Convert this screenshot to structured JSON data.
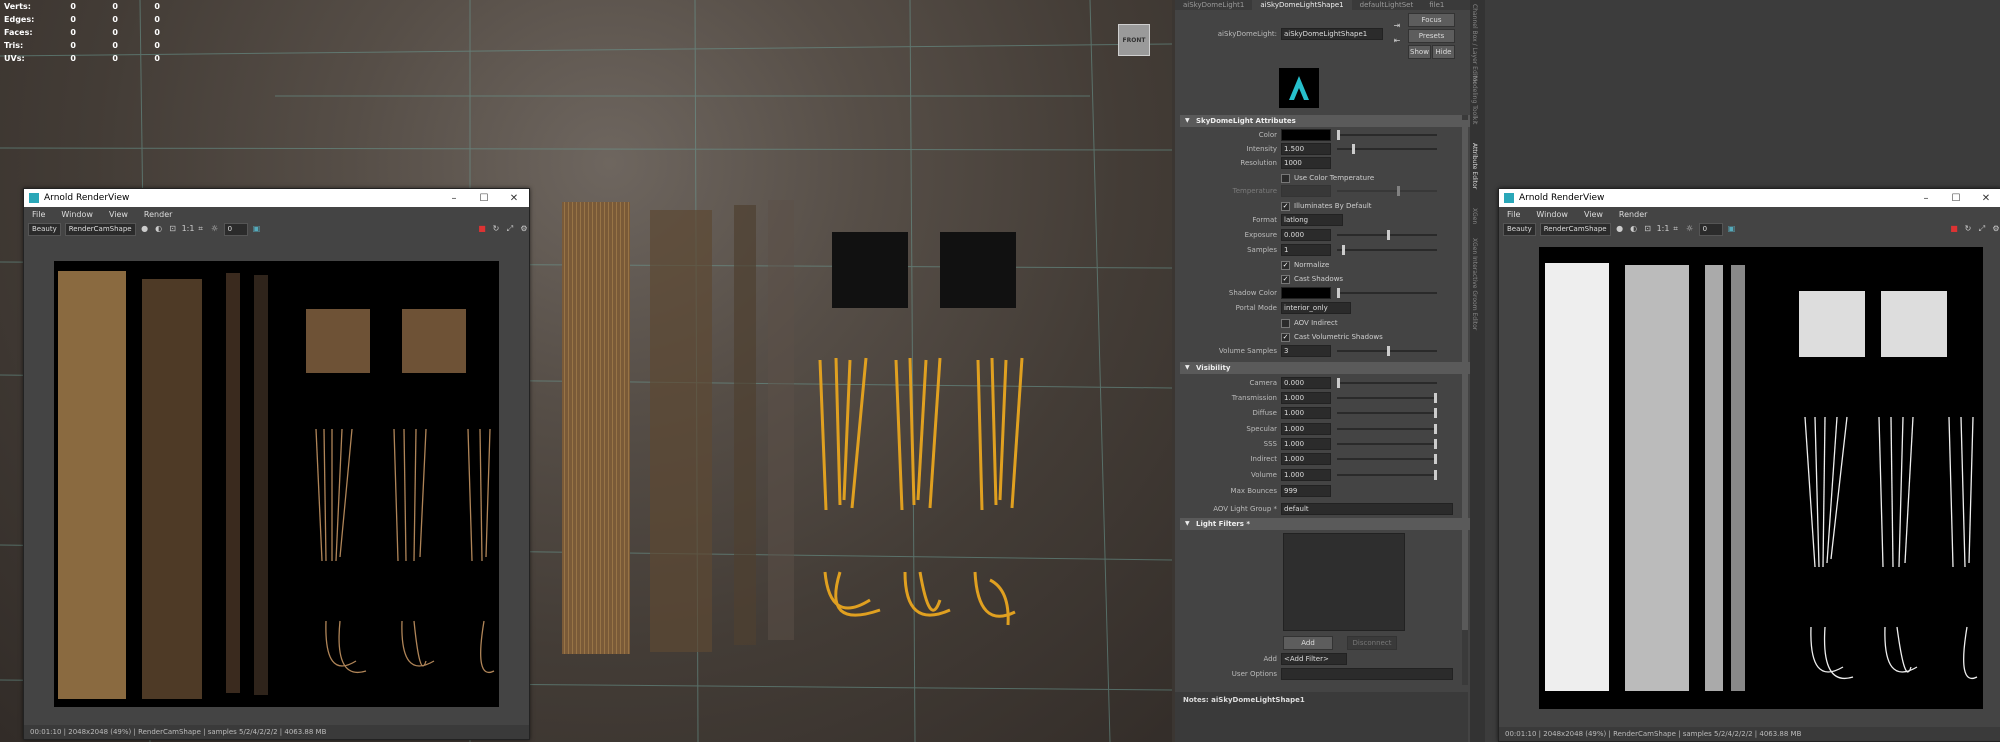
{
  "viewport": {
    "hud_labels": [
      "Verts:",
      "Edges:",
      "Faces:",
      "Tris:",
      "UVs:"
    ],
    "hud_values": [
      [
        "0",
        "0",
        "0"
      ],
      [
        "0",
        "0",
        "0"
      ],
      [
        "0",
        "0",
        "0"
      ],
      [
        "0",
        "0",
        "0"
      ],
      [
        "0",
        "0",
        "0"
      ]
    ],
    "cube_label": "FRONT"
  },
  "renderview_left": {
    "title": "Arnold RenderView",
    "menu": [
      "File",
      "Window",
      "View",
      "Render"
    ],
    "aov": "Beauty",
    "camera": "RenderCamShape",
    "zoom_ratio": "1:1",
    "exposure": "0",
    "status": "00:01:10 | 2048x2048 (49%) | RenderCamShape  | samples 5/2/4/2/2/2 | 4063.88 MB"
  },
  "attribute_editor": {
    "tabs": [
      "aiSkyDomeLight1",
      "aiSkyDomeLightShape1",
      "defaultLightSet",
      "file1"
    ],
    "node_label": "aiSkyDomeLight:",
    "node_name": "aiSkyDomeLightShape1",
    "buttons": {
      "focus": "Focus",
      "presets": "Presets",
      "show": "Show",
      "hide": "Hide"
    },
    "section_sky": "SkyDomeLight Attributes",
    "color_label": "Color",
    "intensity_label": "Intensity",
    "intensity": "1.500",
    "resolution_label": "Resolution",
    "resolution": "1000",
    "use_color_temp": "Use Color Temperature",
    "temperature_label": "Temperature",
    "illum_default": "Illuminates By Default",
    "format_label": "Format",
    "format": "latlong",
    "exposure_label": "Exposure",
    "exposure": "0.000",
    "samples_label": "Samples",
    "samples": "1",
    "normalize": "Normalize",
    "cast_shadows": "Cast Shadows",
    "shadow_color_label": "Shadow Color",
    "portal_mode_label": "Portal Mode",
    "portal_mode": "interior_only",
    "aov_indirect": "AOV Indirect",
    "cast_vol_shadows": "Cast Volumetric Shadows",
    "volume_samples_label": "Volume Samples",
    "volume_samples": "3",
    "section_visibility": "Visibility",
    "vis_rows": [
      {
        "label": "Camera",
        "value": "0.000"
      },
      {
        "label": "Transmission",
        "value": "1.000"
      },
      {
        "label": "Diffuse",
        "value": "1.000"
      },
      {
        "label": "Specular",
        "value": "1.000"
      },
      {
        "label": "SSS",
        "value": "1.000"
      },
      {
        "label": "Indirect",
        "value": "1.000"
      },
      {
        "label": "Volume",
        "value": "1.000"
      }
    ],
    "max_bounces_label": "Max Bounces",
    "max_bounces": "999",
    "aov_group_label": "AOV Light Group *",
    "aov_group": "default",
    "section_filters": "Light Filters *",
    "add_label": "Add",
    "disconnect_label": "Disconnect",
    "add_filter_label": "Add",
    "add_filter": "<Add Filter>",
    "user_options_label": "User Options",
    "notes": "Notes:  aiSkyDomeLightShape1",
    "side_tabs": [
      "Channel Box / Layer Editor",
      "Modeling Toolkit",
      "Attribute Editor",
      "XGen",
      "XGen Interactive Groom Editor"
    ]
  },
  "renderview_right": {
    "title": "Arnold RenderView",
    "menu": [
      "File",
      "Window",
      "View",
      "Render"
    ],
    "aov": "Beauty",
    "camera": "RenderCamShape",
    "zoom_ratio": "1:1",
    "exposure": "0",
    "status": "00:01:10 | 2048x2048 (49%) | RenderCamShape  | samples 5/2/4/2/2/2 | 4063.88 MB"
  },
  "colors": {
    "accent": "#2aa7b8",
    "hair_gold": "#e0a020",
    "hair_brown": "#8a6a45"
  }
}
